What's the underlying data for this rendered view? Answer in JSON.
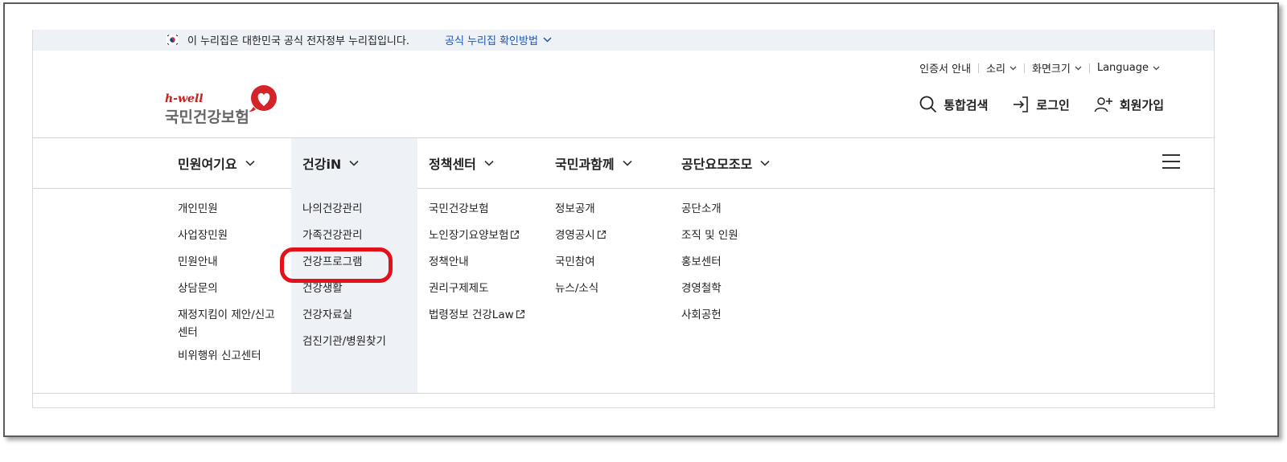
{
  "gov_banner": {
    "text": "이 누리집은 대한민국 공식 전자정부 누리집입니다.",
    "link": "공식 누리집 확인방법"
  },
  "utility": [
    {
      "label": "인증서 안내",
      "dropdown": false
    },
    {
      "label": "소리",
      "dropdown": true
    },
    {
      "label": "화면크기",
      "dropdown": true
    },
    {
      "label": "Language",
      "dropdown": true
    }
  ],
  "logo": {
    "tagline": "h-well",
    "name": "국민건강보험",
    "brand_color": "#c8201d"
  },
  "actions": {
    "search": "통합검색",
    "login": "로그인",
    "signup": "회원가입"
  },
  "gnb": [
    {
      "label": "민원여기요",
      "active": false
    },
    {
      "label": "건강iN",
      "active": true
    },
    {
      "label": "정책센터",
      "active": false
    },
    {
      "label": "국민과함께",
      "active": false
    },
    {
      "label": "공단요모조모",
      "active": false
    }
  ],
  "submenu": {
    "col1": [
      "개인민원",
      "사업장민원",
      "민원안내",
      "상담문의",
      "재정지킴이 제안/신고",
      "센터",
      "비위행위 신고센터"
    ],
    "col2": [
      "나의건강관리",
      "가족건강관리",
      "건강프로그램",
      "건강생활",
      "건강자료실",
      "검진기관/병원찾기"
    ],
    "col3": [
      "국민건강보험",
      "노인장기요양보험",
      "정책안내",
      "권리구제제도",
      "법령정보 건강Law"
    ],
    "col4": [
      "정보공개",
      "경영공시",
      "국민참여",
      "뉴스/소식"
    ],
    "col5": [
      "공단소개",
      "조직 및 인원",
      "홍보센터",
      "경영철학",
      "사회공헌"
    ]
  },
  "colors": {
    "active_bg": "#eef1f6",
    "highlight": "#e3121a",
    "link": "#1a55b4"
  }
}
